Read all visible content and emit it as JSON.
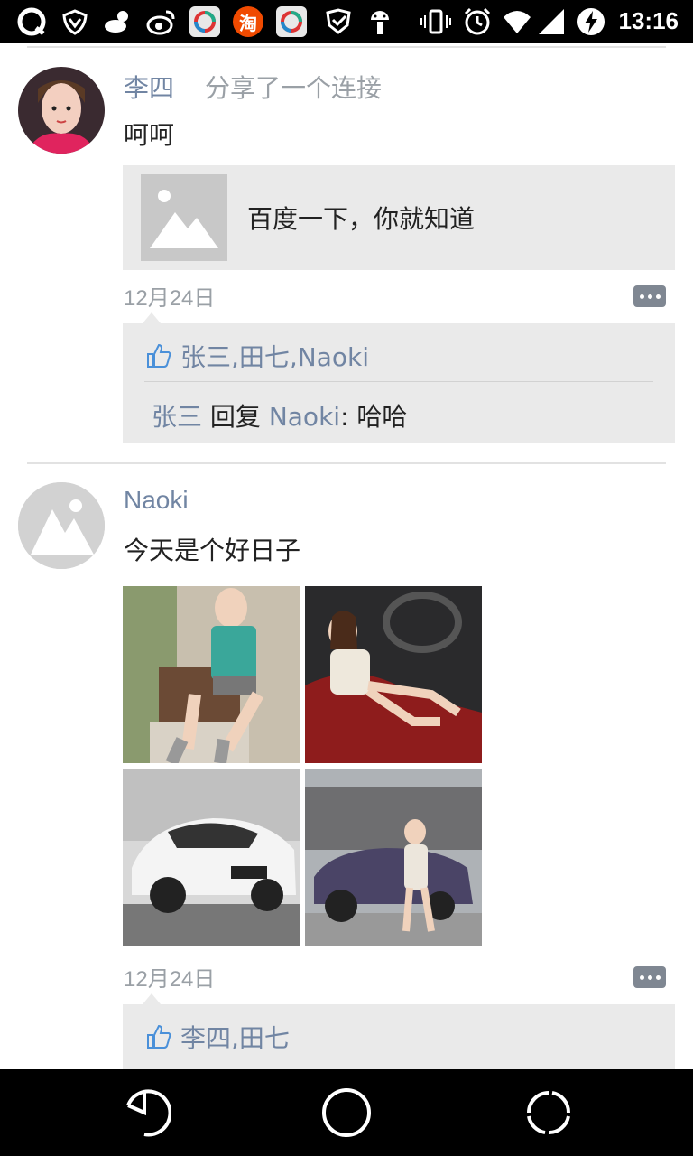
{
  "status_bar": {
    "time": "13:16",
    "taobao_label": "淘",
    "icons": [
      "qq-icon",
      "shield-icon",
      "weather-icon",
      "weibo-icon",
      "app-icon",
      "taobao-icon",
      "app-icon",
      "check-shield-icon",
      "android-icon",
      "vibrate-icon",
      "alarm-icon",
      "wifi-icon",
      "signal-icon",
      "battery-charging-icon"
    ]
  },
  "posts": [
    {
      "author": "李四",
      "action": "分享了一个连接",
      "content": "呵呵",
      "link": {
        "title": "百度一下，你就知道",
        "thumb_icon": "image-placeholder-icon"
      },
      "date": "12月24日",
      "likes": "张三,田七,Naoki",
      "comments": [
        {
          "from": "张三",
          "verb": " 回复 ",
          "to": "Naoki",
          "text": ": 哈哈"
        }
      ]
    },
    {
      "author": "Naoki",
      "content": "今天是个好日子",
      "photos": [
        "photo-girl-chair",
        "photo-girl-car-interior",
        "photo-white-sports-car",
        "photo-girl-purple-car"
      ],
      "date": "12月24日",
      "likes": "李四,田七"
    }
  ],
  "nav_bar": {
    "icons": [
      "back-icon",
      "home-icon",
      "recents-icon"
    ]
  },
  "colors": {
    "accent_name": "#7185a3",
    "card_bg": "#eaeaea",
    "statusbar_bg": "#000000"
  }
}
